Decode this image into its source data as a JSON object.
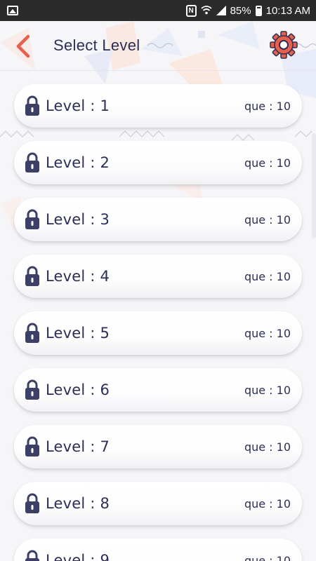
{
  "status_bar": {
    "battery_percent": "85%",
    "time": "10:13 AM",
    "nfc_label": "N",
    "icons": [
      "gallery-icon",
      "nfc-icon",
      "wifi-icon",
      "signal-icon",
      "battery-icon"
    ]
  },
  "header": {
    "title": "Select Level",
    "back_icon": "chevron-left-icon",
    "settings_icon": "gear-icon"
  },
  "colors": {
    "accent": "#e8604c",
    "text_dark": "#2b2f55",
    "lock": "#3c4066",
    "card_bg": "#ffffff",
    "page_bg": "#f6f6f9"
  },
  "levels": [
    {
      "label": "Level : 1",
      "questions": "que : 10",
      "locked": true
    },
    {
      "label": "Level : 2",
      "questions": "que : 10",
      "locked": true
    },
    {
      "label": "Level : 3",
      "questions": "que : 10",
      "locked": true
    },
    {
      "label": "Level : 4",
      "questions": "que : 10",
      "locked": true
    },
    {
      "label": "Level : 5",
      "questions": "que : 10",
      "locked": true
    },
    {
      "label": "Level : 6",
      "questions": "que : 10",
      "locked": true
    },
    {
      "label": "Level : 7",
      "questions": "que : 10",
      "locked": true
    },
    {
      "label": "Level : 8",
      "questions": "que : 10",
      "locked": true
    },
    {
      "label": "Level : 9",
      "questions": "que : 10",
      "locked": true
    }
  ]
}
